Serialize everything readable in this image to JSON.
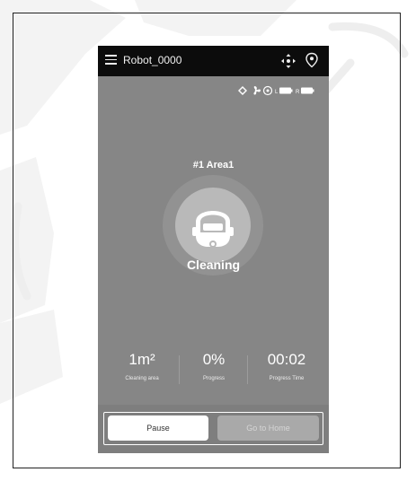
{
  "app": {
    "title": "Robot_0000"
  },
  "status": {
    "left_label": "L",
    "right_label": "R"
  },
  "area": {
    "name": "#1 Area1"
  },
  "state": "Cleaning",
  "stats": [
    {
      "value": "1m²",
      "label": "Cleaning area"
    },
    {
      "value": "0%",
      "label": "Progress"
    },
    {
      "value": "00:02",
      "label": "Progress Time"
    }
  ],
  "buttons": {
    "pause": "Pause",
    "home": "Go to Home"
  },
  "icons": {
    "menu": "menu-icon",
    "move": "move-arrows-icon",
    "location": "location-pin-icon",
    "status": [
      "diamond-icon",
      "fan-icon",
      "cleaning-mode-icon",
      "battery-left-icon",
      "battery-right-icon"
    ]
  },
  "colors": {
    "appbar": "#0c0c0c",
    "screen": "#868686",
    "button_active": "#ffffff",
    "button_disabled": "#a9a9a9"
  }
}
